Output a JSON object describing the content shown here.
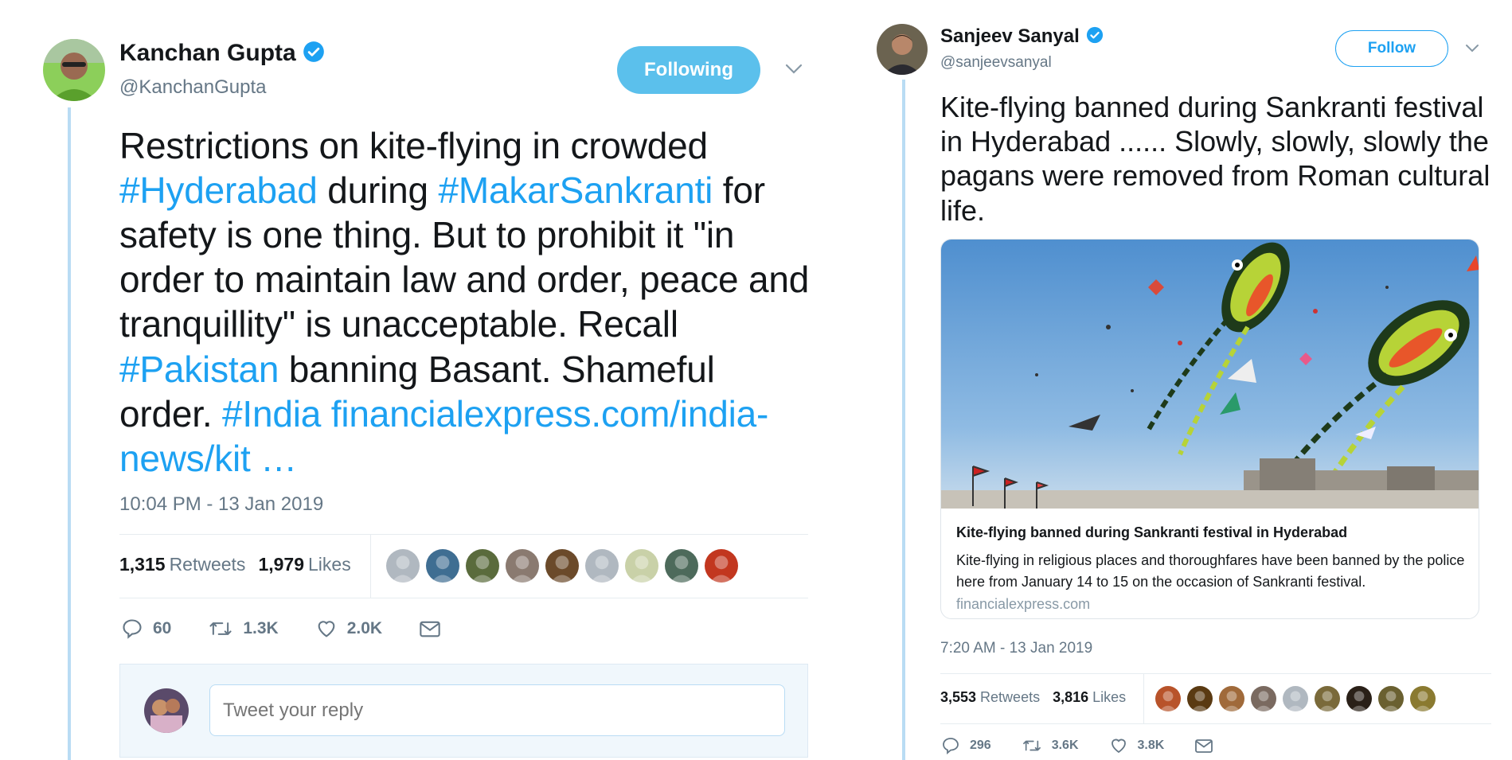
{
  "tweet_left": {
    "author": {
      "name": "Kanchan Gupta",
      "handle": "@KanchanGupta",
      "verified": true
    },
    "follow_button": "Following",
    "text_segments": [
      {
        "t": "Restrictions on kite-flying in crowded ",
        "tag": false
      },
      {
        "t": "#Hyderabad",
        "tag": true
      },
      {
        "t": " during ",
        "tag": false
      },
      {
        "t": "#MakarSankranti",
        "tag": true
      },
      {
        "t": " for safety is one thing. But to prohibit it \"in order to maintain law and order, peace and tranquillity\" is unacceptable. Recall ",
        "tag": false
      },
      {
        "t": "#Pakistan",
        "tag": true
      },
      {
        "t": " banning Basant. Shameful order. ",
        "tag": false
      },
      {
        "t": "#India",
        "tag": true
      },
      {
        "t": " ",
        "tag": false
      },
      {
        "t": "financialexpress.com/india-news/kit …",
        "tag": true
      }
    ],
    "timestamp": "10:04 PM - 13 Jan 2019",
    "stats": {
      "retweets_count": "1,315",
      "retweets_label": "Retweets",
      "likes_count": "1,979",
      "likes_label": "Likes"
    },
    "actions": {
      "replies": "60",
      "retweets": "1.3K",
      "likes": "2.0K"
    },
    "reply_placeholder": "Tweet your reply",
    "liker_colors": [
      "#b0b8c0",
      "#3f6e92",
      "#5a6b3c",
      "#8a7a70",
      "#6b4a2a",
      "#b0b8c0",
      "#c9d1a8",
      "#4d6a5b",
      "#c2371f"
    ]
  },
  "tweet_right": {
    "author": {
      "name": "Sanjeev Sanyal",
      "handle": "@sanjeevsanyal",
      "verified": true
    },
    "follow_button": "Follow",
    "text": "Kite-flying banned during Sankranti festival in Hyderabad ...... Slowly, slowly, slowly the pagans were removed from Roman cultural life.",
    "card": {
      "title": "Kite-flying banned during Sankranti festival in Hyderabad",
      "description": "Kite-flying in religious places and thoroughfares have been banned by the police here from January 14 to 15 on the occasion of Sankranti festival.",
      "domain": "financialexpress.com"
    },
    "timestamp": "7:20 AM - 13 Jan 2019",
    "stats": {
      "retweets_count": "3,553",
      "retweets_label": "Retweets",
      "likes_count": "3,816",
      "likes_label": "Likes"
    },
    "actions": {
      "replies": "296",
      "retweets": "3.6K",
      "likes": "3.8K"
    },
    "liker_colors": [
      "#b8532a",
      "#5a3a12",
      "#a06a3a",
      "#7a6a60",
      "#b0b8c0",
      "#7a6a3a",
      "#2a2018",
      "#6a6030",
      "#8a7a30"
    ]
  }
}
